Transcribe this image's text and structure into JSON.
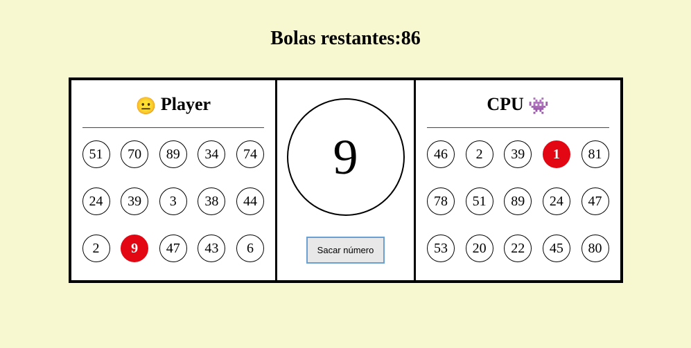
{
  "header": {
    "label_prefix": "Bolas restantes:",
    "remaining": 86
  },
  "current_ball": 9,
  "draw_button_label": "Sacar número",
  "player": {
    "icon": "😐",
    "title": "Player",
    "card": [
      [
        {
          "n": 51,
          "marked": false
        },
        {
          "n": 70,
          "marked": false
        },
        {
          "n": 89,
          "marked": false
        },
        {
          "n": 34,
          "marked": false
        },
        {
          "n": 74,
          "marked": false
        }
      ],
      [
        {
          "n": 24,
          "marked": false
        },
        {
          "n": 39,
          "marked": false
        },
        {
          "n": 3,
          "marked": false
        },
        {
          "n": 38,
          "marked": false
        },
        {
          "n": 44,
          "marked": false
        }
      ],
      [
        {
          "n": 2,
          "marked": false
        },
        {
          "n": 9,
          "marked": true
        },
        {
          "n": 47,
          "marked": false
        },
        {
          "n": 43,
          "marked": false
        },
        {
          "n": 6,
          "marked": false
        }
      ]
    ]
  },
  "cpu": {
    "icon": "👾",
    "title": "CPU",
    "card": [
      [
        {
          "n": 46,
          "marked": false
        },
        {
          "n": 2,
          "marked": false
        },
        {
          "n": 39,
          "marked": false
        },
        {
          "n": 1,
          "marked": true
        },
        {
          "n": 81,
          "marked": false
        }
      ],
      [
        {
          "n": 78,
          "marked": false
        },
        {
          "n": 51,
          "marked": false
        },
        {
          "n": 89,
          "marked": false
        },
        {
          "n": 24,
          "marked": false
        },
        {
          "n": 47,
          "marked": false
        }
      ],
      [
        {
          "n": 53,
          "marked": false
        },
        {
          "n": 20,
          "marked": false
        },
        {
          "n": 22,
          "marked": false
        },
        {
          "n": 45,
          "marked": false
        },
        {
          "n": 80,
          "marked": false
        }
      ]
    ]
  }
}
